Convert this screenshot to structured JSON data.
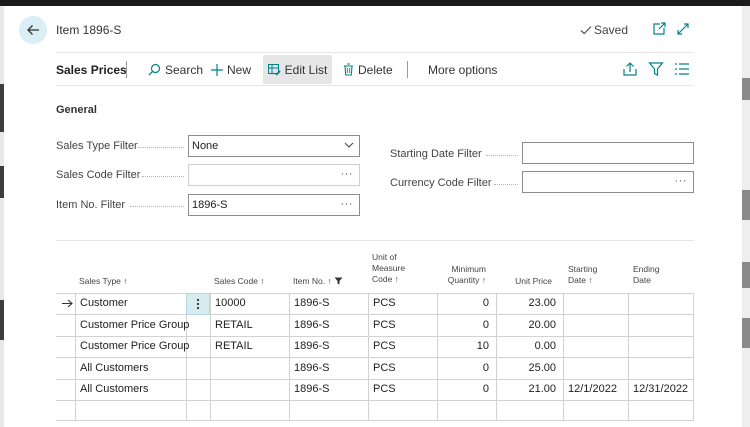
{
  "header": {
    "title": "Item 1896-S",
    "saved": "Saved"
  },
  "actionbar": {
    "page_name": "Sales Prices",
    "search": "Search",
    "new": "New",
    "edit_list": "Edit List",
    "delete": "Delete",
    "more_options": "More options"
  },
  "general": {
    "title": "General",
    "sales_type_filter_label": "Sales Type Filter",
    "sales_type_filter_value": "None",
    "sales_code_filter_label": "Sales Code Filter",
    "sales_code_filter_value": "",
    "item_no_filter_label": "Item No. Filter",
    "item_no_filter_value": "1896-S",
    "starting_date_filter_label": "Starting Date Filter",
    "starting_date_filter_value": "",
    "currency_code_filter_label": "Currency Code Filter",
    "currency_code_filter_value": ""
  },
  "table": {
    "headers": {
      "sales_type": "Sales Type ↑",
      "sales_code": "Sales Code ↑",
      "item_no": "Item No. ↑",
      "uom_1": "Unit of",
      "uom_2": "Measure",
      "uom_3": "Code ↑",
      "min_qty_1": "Minimum",
      "min_qty_2": "Quantity ↑",
      "unit_price": "Unit Price",
      "start_1": "Starting",
      "start_2": "Date ↑",
      "end_1": "Ending",
      "end_2": "Date"
    },
    "rows": [
      {
        "sales_type": "Customer",
        "sales_code": "10000",
        "item_no": "1896-S",
        "uom": "PCS",
        "min_qty": "0",
        "unit_price": "23.00",
        "start": "",
        "end": ""
      },
      {
        "sales_type": "Customer Price Group",
        "sales_code": "RETAIL",
        "item_no": "1896-S",
        "uom": "PCS",
        "min_qty": "0",
        "unit_price": "20.00",
        "start": "",
        "end": ""
      },
      {
        "sales_type": "Customer Price Group",
        "sales_code": "RETAIL",
        "item_no": "1896-S",
        "uom": "PCS",
        "min_qty": "10",
        "unit_price": "0.00",
        "start": "",
        "end": ""
      },
      {
        "sales_type": "All Customers",
        "sales_code": "",
        "item_no": "1896-S",
        "uom": "PCS",
        "min_qty": "0",
        "unit_price": "25.00",
        "start": "",
        "end": ""
      },
      {
        "sales_type": "All Customers",
        "sales_code": "",
        "item_no": "1896-S",
        "uom": "PCS",
        "min_qty": "0",
        "unit_price": "21.00",
        "start": "12/1/2022",
        "end": "12/31/2022"
      }
    ]
  },
  "colors": {
    "accent": "#008489",
    "selected_cell": "#d7ecf1",
    "back_button": "#d9eef5"
  }
}
